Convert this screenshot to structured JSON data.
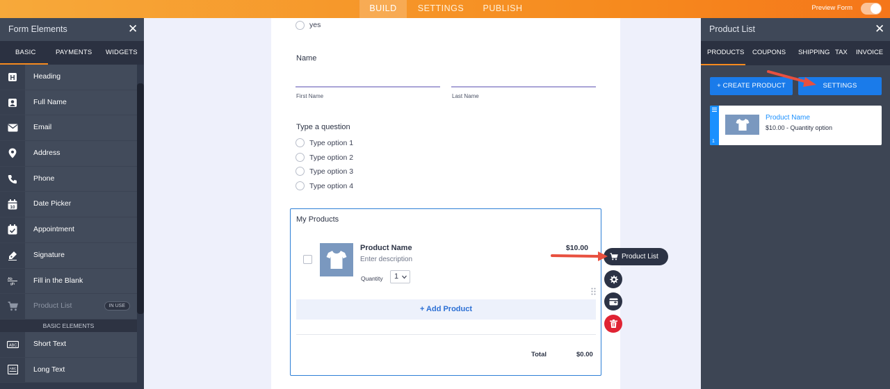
{
  "topbar": {
    "tabs": [
      "BUILD",
      "SETTINGS",
      "PUBLISH"
    ],
    "preview_label": "Preview Form"
  },
  "left_panel": {
    "title": "Form Elements",
    "tabs": [
      "BASIC",
      "PAYMENTS",
      "WIDGETS"
    ],
    "items": [
      {
        "label": "Heading",
        "icon": "heading-icon"
      },
      {
        "label": "Full Name",
        "icon": "person-icon"
      },
      {
        "label": "Email",
        "icon": "envelope-icon"
      },
      {
        "label": "Address",
        "icon": "location-pin-icon"
      },
      {
        "label": "Phone",
        "icon": "phone-icon"
      },
      {
        "label": "Date Picker",
        "icon": "calendar-icon"
      },
      {
        "label": "Appointment",
        "icon": "calendar-check-icon"
      },
      {
        "label": "Signature",
        "icon": "pen-icon"
      },
      {
        "label": "Fill in the Blank",
        "icon": "fill-blank-icon"
      },
      {
        "label": "Product List",
        "icon": "cart-icon",
        "badge": "IN USE"
      }
    ],
    "section_label": "BASIC ELEMENTS",
    "basic_items": [
      {
        "label": "Short Text",
        "icon": "short-text-icon"
      },
      {
        "label": "Long Text",
        "icon": "long-text-icon"
      }
    ]
  },
  "form": {
    "top_option": "yes",
    "name_field": {
      "title": "Name",
      "first_label": "First Name",
      "last_label": "Last Name"
    },
    "question": {
      "title": "Type a question",
      "options": [
        "Type option 1",
        "Type option 2",
        "Type option 3",
        "Type option 4"
      ]
    },
    "products": {
      "title": "My Products",
      "product_name": "Product Name",
      "description": "Enter description",
      "price": "$10.00",
      "quantity_label": "Quantity",
      "quantity_value": "1",
      "add_label": "+ Add Product",
      "total_label": "Total",
      "total_value": "$0.00"
    },
    "tooltip": "Product List"
  },
  "right_panel": {
    "title": "Product List",
    "tabs": [
      "PRODUCTS",
      "COUPONS",
      "SHIPPING",
      "TAX",
      "INVOICE"
    ],
    "create_label": "+ CREATE PRODUCT",
    "settings_label": "SETTINGS",
    "card": {
      "name": "Product Name",
      "detail": "$10.00 - Quantity option",
      "index": "1"
    }
  },
  "colors": {
    "accent_orange": "#f68a1e",
    "button_blue": "#1a7bea",
    "link_blue": "#1a90ff",
    "delete_red": "#e02433",
    "arrow_red": "#e8503f"
  }
}
